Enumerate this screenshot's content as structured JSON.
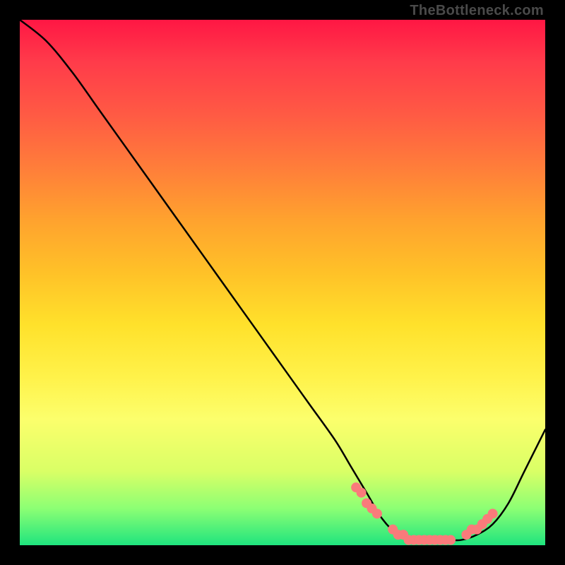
{
  "attribution": "TheBottleneck.com",
  "chart_data": {
    "type": "line",
    "title": "",
    "xlabel": "",
    "ylabel": "",
    "xlim": [
      0,
      100
    ],
    "ylim": [
      0,
      100
    ],
    "series": [
      {
        "name": "bottleneck-curve",
        "x": [
          0,
          5,
          10,
          15,
          20,
          25,
          30,
          35,
          40,
          45,
          50,
          55,
          60,
          63,
          66,
          69,
          72,
          75,
          78,
          81,
          84,
          87,
          90,
          93,
          96,
          100
        ],
        "y": [
          100,
          96,
          90,
          83,
          76,
          69,
          62,
          55,
          48,
          41,
          34,
          27,
          20,
          15,
          10,
          5,
          2,
          1,
          1,
          1,
          1,
          2,
          4,
          8,
          14,
          22
        ]
      }
    ],
    "markers": {
      "name": "highlight-points",
      "x": [
        64,
        65,
        66,
        67,
        68,
        71,
        72,
        73,
        74,
        75,
        76,
        77,
        78,
        79,
        80,
        81,
        82,
        85,
        86,
        87,
        88,
        89,
        90
      ],
      "y": [
        11,
        10,
        8,
        7,
        6,
        3,
        2,
        2,
        1,
        1,
        1,
        1,
        1,
        1,
        1,
        1,
        1,
        2,
        3,
        3,
        4,
        5,
        6
      ]
    },
    "colors": {
      "curve": "#000000",
      "marker_fill": "#f97b7b",
      "marker_stroke": "#f97b7b"
    }
  }
}
